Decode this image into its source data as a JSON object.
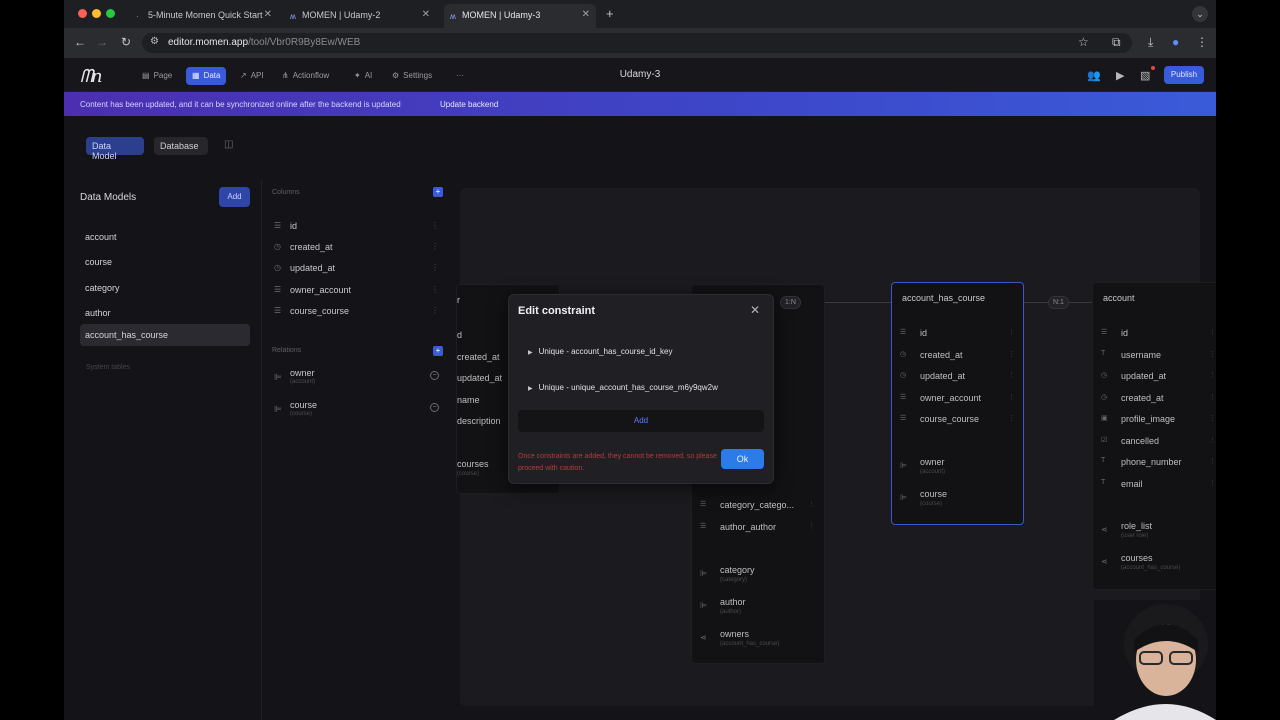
{
  "browser": {
    "tabs": [
      {
        "title": "5-Minute Momen Quick Start"
      },
      {
        "title": "MOMEN | Udamy-2"
      },
      {
        "title": "MOMEN | Udamy-3"
      }
    ],
    "url_host": "editor.momen.app",
    "url_path": "/tool/Vbr0R9By8Ew/WEB"
  },
  "app": {
    "nav": [
      {
        "label": "Page",
        "icon": "page-icon"
      },
      {
        "label": "Data",
        "icon": "data-icon"
      },
      {
        "label": "API",
        "icon": "api-icon"
      },
      {
        "label": "Actionflow",
        "icon": "actionflow-icon"
      },
      {
        "label": "AI",
        "icon": "ai-icon"
      },
      {
        "label": "Settings",
        "icon": "gear-icon"
      }
    ],
    "project_title": "Udamy-3",
    "publish_label": "Publish"
  },
  "banner": {
    "message": "Content has been updated, and it can be synchronized online after the backend is updated",
    "link": "Update backend"
  },
  "tabs": {
    "data_model": "Data Model",
    "database": "Database"
  },
  "models": {
    "title": "Data Models",
    "add_label": "Add",
    "items": [
      "account",
      "course",
      "category",
      "author",
      "account_has_course"
    ],
    "selected": "account_has_course",
    "system_tables": "System tables"
  },
  "columns": {
    "title": "Columns",
    "items": [
      "id",
      "created_at",
      "updated_at",
      "owner_account",
      "course_course"
    ],
    "relations_title": "Relations",
    "relations": [
      {
        "name": "owner",
        "target": "(account)"
      },
      {
        "name": "course",
        "target": "(course)"
      }
    ]
  },
  "canvas": {
    "left_card": {
      "title": "r",
      "rows": [
        "d",
        "created_at",
        "updated_at",
        "name",
        "description"
      ],
      "rel": {
        "name": "courses",
        "target": "(course)"
      }
    },
    "course_card": {
      "rows": [
        "category_catego...",
        "author_author"
      ],
      "rels": [
        {
          "name": "category",
          "target": "(category)"
        },
        {
          "name": "author",
          "target": "(author)"
        },
        {
          "name": "owners",
          "target": "(account_has_course)"
        }
      ]
    },
    "ahc_card": {
      "title": "account_has_course",
      "rows": [
        "id",
        "created_at",
        "updated_at",
        "owner_account",
        "course_course"
      ],
      "rels": [
        {
          "name": "owner",
          "target": "(account)"
        },
        {
          "name": "course",
          "target": "(course)"
        }
      ]
    },
    "account_card": {
      "title": "account",
      "rows": [
        "id",
        "username",
        "updated_at",
        "created_at",
        "profile_image",
        "cancelled",
        "phone_number",
        "email"
      ],
      "rels": [
        {
          "name": "role_list",
          "target": "(user role)"
        },
        {
          "name": "courses",
          "target": "(account_has_course)"
        }
      ]
    },
    "connector_1n": "1:N",
    "connector_n1": "N:1"
  },
  "modal": {
    "title": "Edit constraint",
    "constraints": [
      "Unique - account_has_course_id_key",
      "Unique - unique_account_has_course_m6y9qw2w"
    ],
    "add_label": "Add",
    "warning": "Once constraints are added, they cannot be removed, so please proceed with caution.",
    "ok_label": "Ok"
  },
  "colors": {
    "accent": "#3a5bd9",
    "ok": "#2d7be6",
    "warning": "#b83a3a"
  }
}
